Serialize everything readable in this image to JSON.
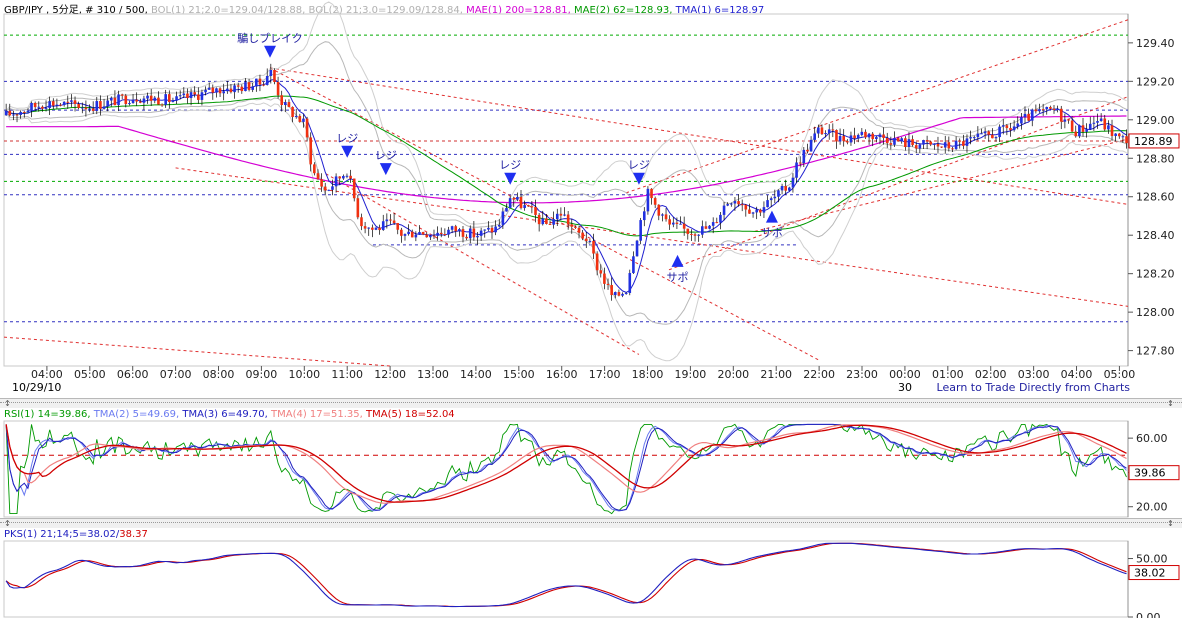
{
  "main_header": [
    {
      "text": "GBP/JPY , 5分足, # 310 / 500, ",
      "color": "#000000"
    },
    {
      "text": "BOL(1) 21;2.0=129.04/128.88, BOL(2) 21;3.0=129.09/128.84, ",
      "color": "#b0b0b0"
    },
    {
      "text": "MAE(1) 200=128.81, ",
      "color": "#d400d4"
    },
    {
      "text": "MAE(2) 62=128.93, ",
      "color": "#009900"
    },
    {
      "text": "TMA(1) 6=128.97",
      "color": "#2020d0"
    }
  ],
  "rsi_header": [
    {
      "text": "RSI(1) 14=39.86, ",
      "color": "#009900"
    },
    {
      "text": "TMA(2) 5=49.69, ",
      "color": "#6a7af0"
    },
    {
      "text": "TMA(3) 6=49.70, ",
      "color": "#2020c0"
    },
    {
      "text": "TMA(4) 17=51.35, ",
      "color": "#f08080"
    },
    {
      "text": "TMA(5) 18=52.04",
      "color": "#d00000"
    }
  ],
  "pks_header": [
    {
      "text": "PKS(1) 21;14;5=38.02/",
      "color": "#2020c0"
    },
    {
      "text": "38.37",
      "color": "#d00000"
    }
  ],
  "date_label_left": "10/29/10",
  "date_label_30": "30",
  "learn_link": "Learn to Trade Directly from Charts",
  "resize_glyph": "↕",
  "chart_data": {
    "type": "candlestick",
    "symbol": "GBP/JPY",
    "timeframe": "5分足",
    "ylim": [
      127.72,
      129.55
    ],
    "y_ticks": [
      "129.40",
      "129.20",
      "129.00",
      "128.80",
      "128.60",
      "128.40",
      "128.20",
      "128.00",
      "127.80"
    ],
    "last_price": "128.89",
    "x_ticks": [
      "04:00",
      "05:00",
      "06:00",
      "07:00",
      "08:00",
      "09:00",
      "10:00",
      "11:00",
      "12:00",
      "13:00",
      "14:00",
      "15:00",
      "16:00",
      "17:00",
      "18:00",
      "19:00",
      "20:00",
      "21:00",
      "22:00",
      "23:00",
      "00:00",
      "01:00",
      "02:00",
      "03:00",
      "04:00",
      "05:00"
    ],
    "x_range_hours": [
      3.0,
      29.2
    ],
    "path_hours": [
      3.0,
      4.0,
      5.0,
      6.0,
      7.0,
      8.0,
      8.5,
      9.0,
      9.2,
      9.5,
      10.0,
      10.2,
      10.5,
      11.0,
      11.3,
      11.6,
      12.0,
      12.3,
      12.6,
      13.0,
      13.5,
      14.0,
      14.5,
      14.8,
      15.3,
      15.6,
      16.0,
      16.3,
      16.6,
      16.8,
      17.2,
      17.5,
      17.7,
      18.0,
      18.5,
      19.0,
      19.5,
      19.8,
      20.0,
      20.5,
      21.0,
      21.3,
      21.5,
      22.0,
      22.5,
      23.0,
      23.5,
      24.0,
      25.0,
      26.0,
      26.5,
      27.0,
      27.5,
      28.0,
      28.5,
      29.0
    ],
    "path_closes": [
      129.02,
      129.09,
      129.07,
      129.12,
      129.1,
      129.16,
      129.17,
      129.19,
      129.26,
      129.08,
      128.98,
      128.73,
      128.63,
      128.74,
      128.47,
      128.43,
      128.46,
      128.4,
      128.42,
      128.41,
      128.43,
      128.4,
      128.44,
      128.6,
      128.52,
      128.45,
      128.52,
      128.42,
      128.38,
      128.25,
      128.07,
      128.12,
      128.35,
      128.62,
      128.45,
      128.42,
      128.44,
      128.56,
      128.6,
      128.52,
      128.6,
      128.66,
      128.78,
      128.95,
      128.9,
      128.93,
      128.91,
      128.88,
      128.86,
      128.92,
      128.96,
      129.03,
      129.05,
      128.94,
      129.0,
      128.9
    ],
    "signals": [
      {
        "label": "騙しブレイク",
        "hour": 9.2,
        "price": 129.26,
        "dir": "down"
      },
      {
        "label": "レジ",
        "hour": 11.0,
        "price": 128.74,
        "dir": "down"
      },
      {
        "label": "レジ",
        "hour": 11.9,
        "price": 128.65,
        "dir": "down"
      },
      {
        "label": "レジ",
        "hour": 14.8,
        "price": 128.6,
        "dir": "down"
      },
      {
        "label": "レジ",
        "hour": 17.8,
        "price": 128.6,
        "dir": "down"
      },
      {
        "label": "サポ",
        "hour": 18.7,
        "price": 128.35,
        "dir": "up"
      },
      {
        "label": "サポ",
        "hour": 20.9,
        "price": 128.58,
        "dir": "up"
      }
    ],
    "rsi": {
      "ylim": [
        14,
        70
      ],
      "y_ticks": [
        "60.00",
        "40.00",
        "20.00"
      ],
      "last": "39.86",
      "level": 50
    },
    "pks": {
      "ylim": [
        0,
        65
      ],
      "y_ticks": [
        "50.00",
        "0.00"
      ],
      "last": "38.02"
    }
  }
}
